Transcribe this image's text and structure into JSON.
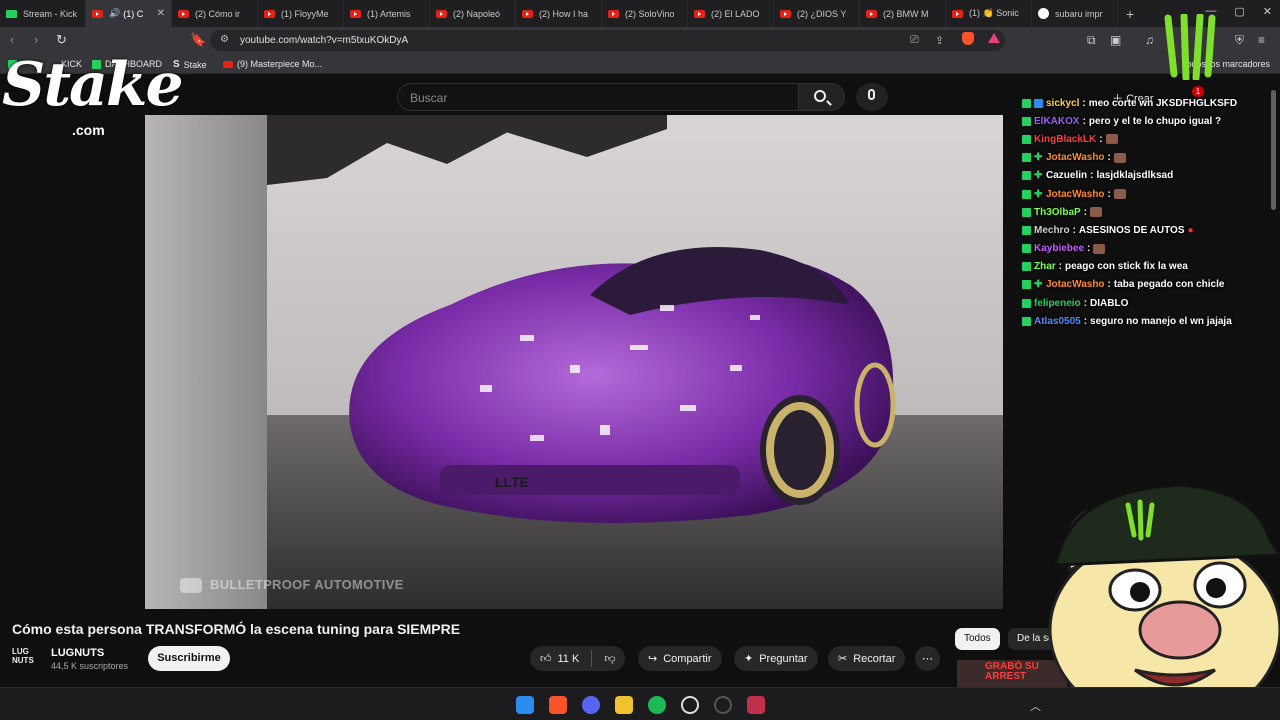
{
  "browser": {
    "tabs": [
      {
        "label": "Stream - Kick",
        "icon": "kick-icon"
      },
      {
        "label": "(1) C",
        "icon": "youtube-icon",
        "active": true
      },
      {
        "label": "(2) Cómo ir",
        "icon": "youtube-icon"
      },
      {
        "label": "(1) FloyyMe",
        "icon": "youtube-icon"
      },
      {
        "label": "(1) Artemis",
        "icon": "youtube-icon"
      },
      {
        "label": "(2) Napoleó",
        "icon": "youtube-icon"
      },
      {
        "label": "(2) How I ha",
        "icon": "youtube-icon"
      },
      {
        "label": "(2) SoloVino",
        "icon": "youtube-icon"
      },
      {
        "label": "(2) El LADO",
        "icon": "youtube-icon"
      },
      {
        "label": "(2) ¿DIOS Y",
        "icon": "youtube-icon"
      },
      {
        "label": "(2) BMW M",
        "icon": "youtube-icon"
      },
      {
        "label": "(1) 👏 Sonic",
        "icon": "youtube-icon"
      },
      {
        "label": "subaru impr",
        "icon": "google-icon"
      }
    ],
    "new_tab": "+",
    "url": "youtube.com/watch?v=m5txuKOkDyA",
    "bookmarks": [
      {
        "label": "KICK",
        "icon": "kick-icon"
      },
      {
        "label": "DASHBOARD",
        "icon": "kick-icon"
      },
      {
        "label": "Stake",
        "icon": "stake-icon"
      },
      {
        "label": "(9) Masterpiece Mo...",
        "icon": "youtube-icon"
      }
    ],
    "all_bookmarks": "Todos los marcadores"
  },
  "youtube": {
    "search_placeholder": "Buscar",
    "create_label": "Crear",
    "notification_count": "1",
    "video_watermark": "BULLETPROOF AUTOMOTIVE",
    "video_title": "Cómo esta persona TRANSFORMÓ la escena tuning para SIEMPRE",
    "channel": {
      "name": "LUGNUTS",
      "logo_text": "LUG NUTS",
      "subscribers": "44,5 K suscriptores"
    },
    "subscribe_label": "Suscribirme",
    "likes": "11 K",
    "share_label": "Compartir",
    "ask_label": "Preguntar",
    "clip_label": "Recortar",
    "more_label": "⋯",
    "chips": [
      "Todos",
      "De la serie"
    ],
    "related_text": "GRABÓ SU ARREST"
  },
  "chat": [
    {
      "user": "sickycl",
      "color": "#ffd23f",
      "badge": "kick-bot",
      "text": "meo corte wn JKSDFHGLKSFD",
      "emote": false
    },
    {
      "user": "ElKAKOX",
      "color": "#9d5cff",
      "badge": "kick",
      "text": "pero y el te lo chupo igual ?",
      "emote": false
    },
    {
      "user": "KingBlackLK",
      "color": "#ff3b3b",
      "badge": "kick",
      "text": "",
      "emote": true
    },
    {
      "user": "JotacWasho",
      "color": "#ff8a2b",
      "badge": "kick-gift",
      "text": "",
      "emote": true
    },
    {
      "user": "Cazuelin",
      "color": "#ffffff",
      "badge": "kick-gift",
      "text": "lasjdklajsdlksad",
      "emote": false
    },
    {
      "user": "JotacWasho",
      "color": "#ff8a2b",
      "badge": "kick-gift",
      "text": "",
      "emote": true
    },
    {
      "user": "Th3OlbaP",
      "color": "#7cff4f",
      "badge": "kick",
      "text": "",
      "emote": true
    },
    {
      "user": "Mechro",
      "color": "#cfcfcf",
      "badge": "kick",
      "text": "ASESINOS DE AUTOS",
      "emote": false,
      "drop": true
    },
    {
      "user": "Kaybiebee",
      "color": "#c65cff",
      "badge": "kick",
      "text": "",
      "emote": true
    },
    {
      "user": "Zhar",
      "color": "#7cff4f",
      "badge": "kick",
      "text": "peago con stick fix la wea",
      "emote": false
    },
    {
      "user": "JotacWasho",
      "color": "#ff8a2b",
      "badge": "kick-gift",
      "text": "taba pegado con chicle",
      "emote": false
    },
    {
      "user": "felipeneio",
      "color": "#23d160",
      "badge": "kick",
      "text": "DIABLO",
      "emote": false
    },
    {
      "user": "Atlas0505",
      "color": "#4f8cff",
      "badge": "kick",
      "text": "seguro no manejo el wn jajaja",
      "emote": false
    }
  ],
  "overlay": {
    "stake_logo": "Stake",
    "stake_domain": ".com"
  },
  "colors": {
    "kick_green": "#23d160",
    "youtube_red": "#e62117",
    "car_purple": "#7a2ca8"
  }
}
